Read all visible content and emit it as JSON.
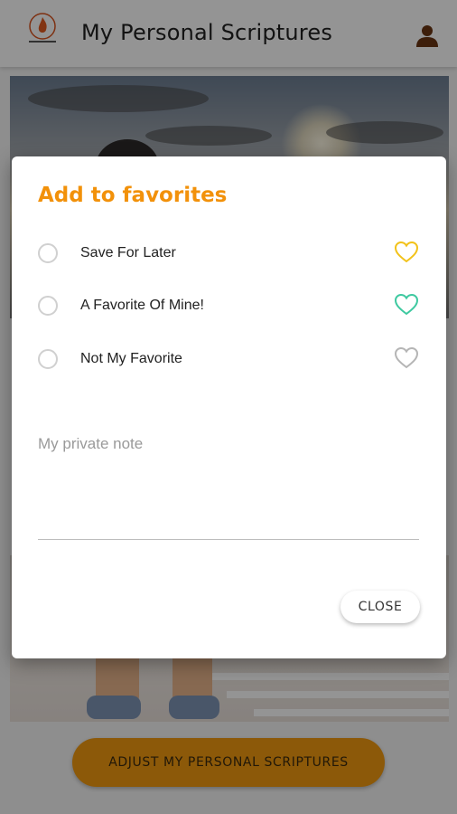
{
  "app_bar": {
    "title": "My Personal Scriptures",
    "logo_icon": "flame-logo-icon",
    "profile_icon": "user-profile-icon"
  },
  "footer": {
    "adjust_button_label": "ADJUST MY PERSONAL SCRIPTURES"
  },
  "dialog": {
    "title": "Add to favorites",
    "options": [
      {
        "label": "Save For Later",
        "selected": false,
        "heart_color": "#f2c21a"
      },
      {
        "label": "A Favorite Of Mine!",
        "selected": false,
        "heart_color": "#3ec9a0"
      },
      {
        "label": "Not My Favorite",
        "selected": false,
        "heart_color": "#b5b5b5"
      }
    ],
    "note_placeholder": "My private note",
    "note_value": "",
    "close_label": "CLOSE"
  },
  "colors": {
    "accent": "#f2910a",
    "button": "#f29a10"
  }
}
